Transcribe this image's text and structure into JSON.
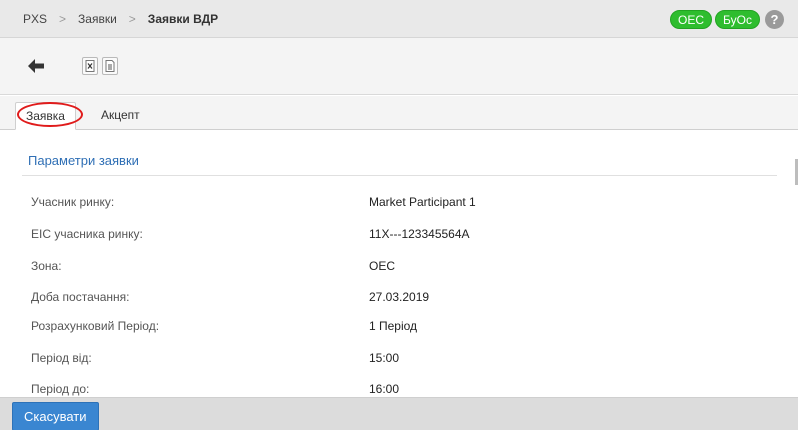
{
  "breadcrumb": {
    "items": [
      "PXS",
      "Заявки"
    ],
    "current": "Заявки ВДР"
  },
  "header": {
    "badges": [
      "ОЕС",
      "БуОс"
    ],
    "help_symbol": "?",
    "badge_color": "#2ebd2e"
  },
  "toolbar": {
    "back_icon": "arrow-left-icon",
    "export_excel_icon": "excel-file-icon",
    "export_doc_icon": "document-icon"
  },
  "tabs": [
    {
      "label": "Заявка",
      "active": true
    },
    {
      "label": "Акцепт",
      "active": false
    }
  ],
  "section": {
    "title": "Параметри заявки",
    "title_color": "#2f6fb5"
  },
  "fields": [
    {
      "label": "Учасник ринку:",
      "value": "Market Participant 1"
    },
    {
      "label": "EIC учасника ринку:",
      "value": "11X---123345564A"
    },
    {
      "label": "Зона:",
      "value": "ОЕС"
    },
    {
      "label": "Доба постачання:",
      "value": "27.03.2019"
    },
    {
      "label": "Розрахунковий Період:",
      "value": "1 Період"
    },
    {
      "label": "Період від:",
      "value": "15:00"
    },
    {
      "label": "Період до:",
      "value": "16:00"
    }
  ],
  "footer": {
    "cancel_label": "Скасувати",
    "button_color": "#3a86d1"
  }
}
